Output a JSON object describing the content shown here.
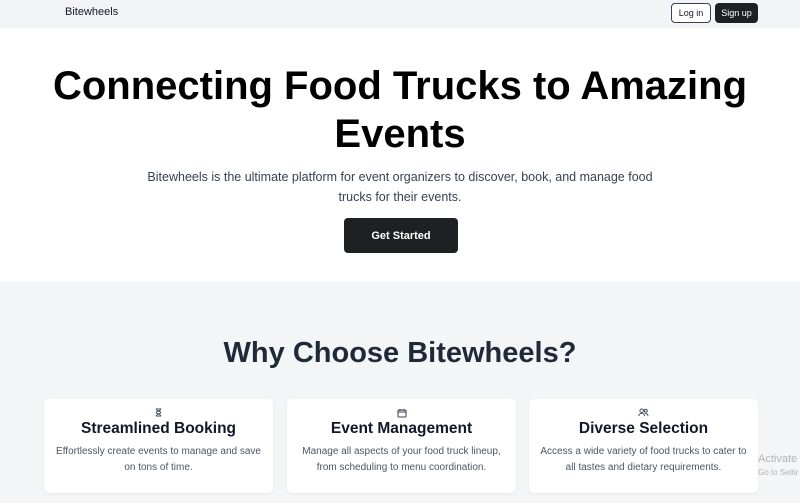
{
  "nav": {
    "brand": "Bitewheels",
    "login_label": "Log in",
    "signup_label": "Sign up"
  },
  "hero": {
    "title": "Connecting Food Trucks to Amazing Events",
    "subtitle": "Bitewheels is the ultimate platform for event organizers to discover, book, and manage food trucks for their events.",
    "cta_label": "Get Started"
  },
  "features": {
    "title": "Why Choose Bitewheels?",
    "cards": [
      {
        "icon": "hourglass-icon",
        "title": "Streamlined Booking",
        "text": "Effortlessly create events to manage and save on tons of time."
      },
      {
        "icon": "calendar-icon",
        "title": "Event Management",
        "text": "Manage all aspects of your food truck lineup, from scheduling to menu coordination."
      },
      {
        "icon": "users-icon",
        "title": "Diverse Selection",
        "text": "Access a wide variety of food trucks to cater to all tastes and dietary requirements."
      }
    ]
  },
  "watermark": {
    "line1": "Activate",
    "line2": "Go to Settir"
  },
  "colors": {
    "primary_button": "#1f2023",
    "nav_background": "#f3f4f6",
    "section_background": "#f4f5f7"
  }
}
